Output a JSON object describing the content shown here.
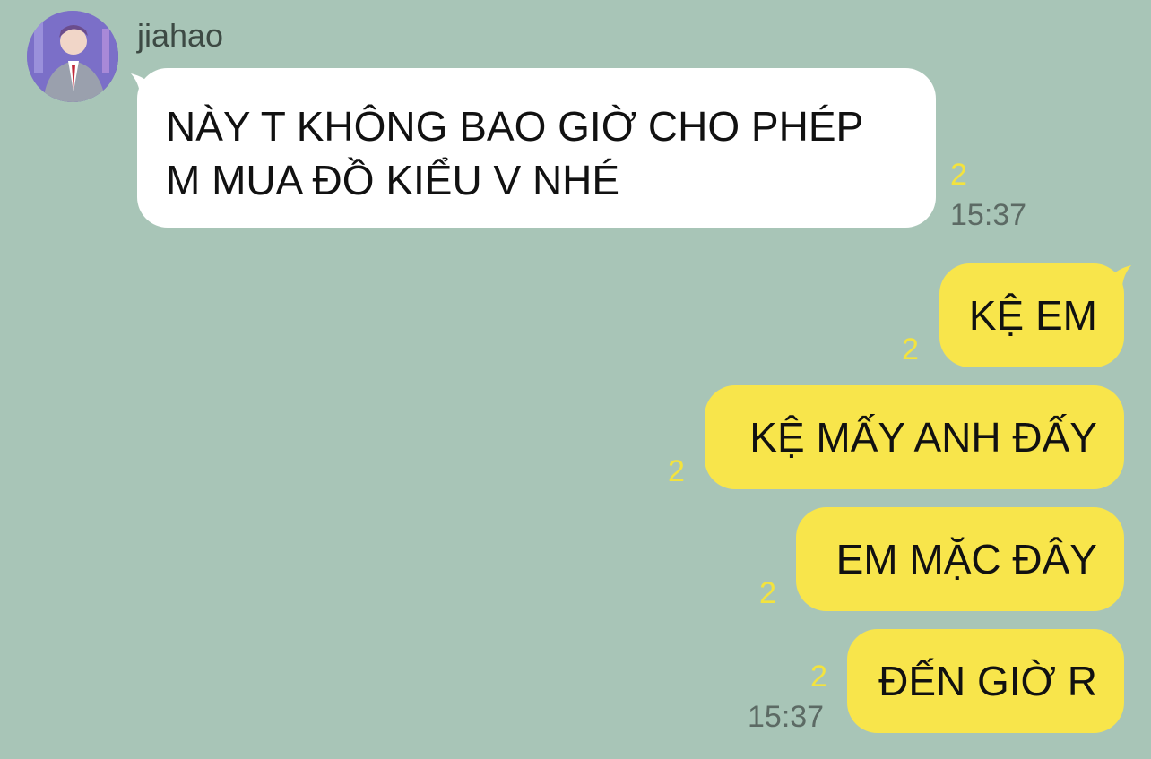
{
  "chat": {
    "sender": {
      "name": "jiahao",
      "avatar": "profile-photo"
    },
    "incoming": {
      "line1": "NÀY T KHÔNG BAO GIỜ CHO PHÉP",
      "line2": "M MUA ĐỒ KIỂU V NHÉ",
      "read_count": "2",
      "time": "15:37"
    },
    "outgoing": [
      {
        "text": "KỆ EM",
        "read_count": "2"
      },
      {
        "text": "KỆ MẤY ANH ĐẤY",
        "read_count": "2"
      },
      {
        "text": "EM MẶC ĐÂY",
        "read_count": "2"
      },
      {
        "text": "ĐẾN GIỜ R",
        "read_count": "2",
        "time": "15:37"
      }
    ]
  },
  "colors": {
    "background": "#a8c5b7",
    "incoming_bubble": "#ffffff",
    "outgoing_bubble": "#f8e54b",
    "read_count": "#f3e33e",
    "time": "#5c6a64"
  }
}
